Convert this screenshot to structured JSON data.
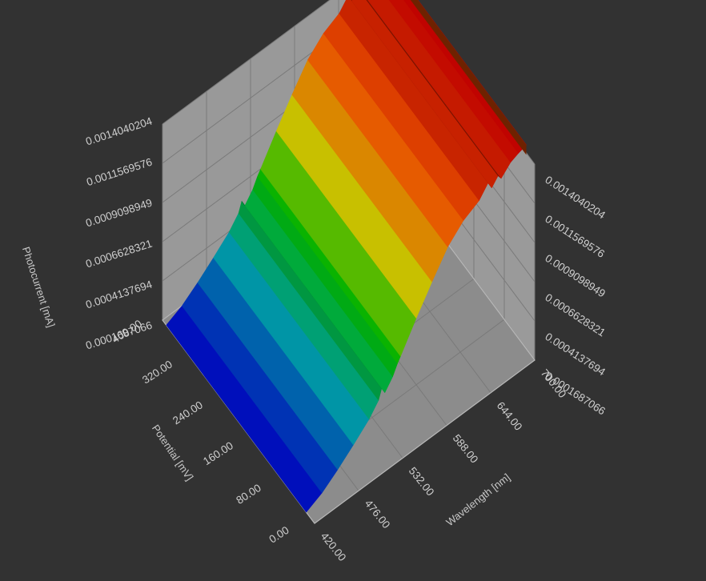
{
  "chart_data": {
    "type": "surface3d",
    "axes": {
      "x": {
        "label": "Potential [mV]",
        "ticks": [
          "0.00",
          "80.00",
          "160.00",
          "240.00",
          "320.00",
          "400.00"
        ],
        "range": [
          0,
          400
        ]
      },
      "y": {
        "label": "Wavelength [nm]",
        "ticks": [
          "420.00",
          "476.00",
          "532.00",
          "588.00",
          "644.00",
          "700.00"
        ],
        "range": [
          420,
          700
        ]
      },
      "z": {
        "label": "Photocurrent [mA]",
        "ticks_left": [
          "0.0001687066",
          "0.0004137694",
          "0.0006628321",
          "0.0009098949",
          "0.0011569576",
          "0.0014040204"
        ],
        "ticks_right": [
          "0.0001687066",
          "0.0004137694",
          "0.0006628321",
          "0.0009098949",
          "0.0011569576",
          "0.0014040204"
        ],
        "range": [
          0.0001687066,
          0.0014040204
        ]
      }
    },
    "wavelength_nm": [
      420,
      440,
      460,
      480,
      500,
      512,
      516,
      520,
      530,
      536,
      540,
      560,
      580,
      600,
      620,
      640,
      652,
      656,
      664,
      668,
      680,
      690,
      700
    ],
    "photocurrent_mA": [
      0.000169,
      0.000215,
      0.000285,
      0.000365,
      0.00045,
      0.000522,
      0.00058,
      0.00054,
      0.000602,
      0.00066,
      0.00069,
      0.00085,
      0.001,
      0.00114,
      0.00123,
      0.00128,
      0.00135,
      0.0013,
      0.001345,
      0.001315,
      0.00137,
      0.00139,
      0.001404
    ],
    "colormap": [
      "#0000b4",
      "#0096a0",
      "#00b400",
      "#c8c800",
      "#e66400",
      "#b40000"
    ],
    "grid": true
  }
}
